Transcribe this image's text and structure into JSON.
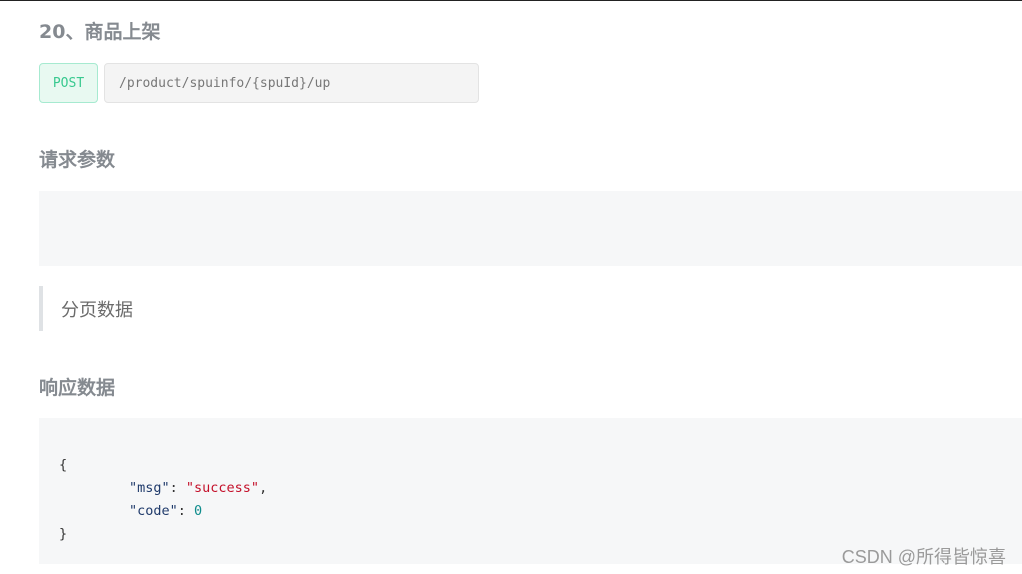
{
  "api": {
    "title": "20、商品上架",
    "method": "POST",
    "url": "/product/spuinfo/{spuId}/up"
  },
  "request": {
    "title": "请求参数",
    "note": "分页数据"
  },
  "response": {
    "title": "响应数据",
    "open_brace": "{",
    "close_brace": "}",
    "fields": [
      {
        "key": "\"msg\"",
        "sep": ": ",
        "value": "\"success\"",
        "trail": ","
      },
      {
        "key": "\"code\"",
        "sep": ": ",
        "value": "0",
        "trail": ""
      }
    ]
  },
  "watermark": "CSDN @所得皆惊喜"
}
